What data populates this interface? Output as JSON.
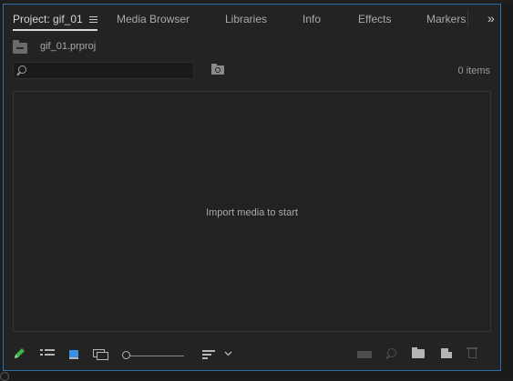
{
  "tabs": [
    {
      "label": "Project: gif_01",
      "active": true
    },
    {
      "label": "Media Browser"
    },
    {
      "label": "Libraries"
    },
    {
      "label": "Info"
    },
    {
      "label": "Effects"
    },
    {
      "label": "Markers"
    }
  ],
  "overflow_label": "»",
  "project": {
    "filename": "gif_01.prproj"
  },
  "search": {
    "value": "",
    "placeholder": ""
  },
  "item_count": "0 items",
  "empty_message": "Import media to start",
  "colors": {
    "accent": "#2f6fa6",
    "icon_view_active": "#3b8fe0",
    "panel_bg": "#232323"
  },
  "icons": {
    "tab_menu": "hamburger-icon",
    "project_bin": "bin-icon",
    "search": "search-icon",
    "new_search_bin": "new-search-bin-icon",
    "footer": [
      "pencil-icon",
      "list-view-icon",
      "icon-view-icon",
      "freeform-view-icon",
      "zoom-slider",
      "sort-icon",
      "chevron-down-icon",
      "automate-to-sequence-icon",
      "find-icon",
      "new-bin-icon",
      "new-item-icon",
      "trash-icon"
    ]
  }
}
